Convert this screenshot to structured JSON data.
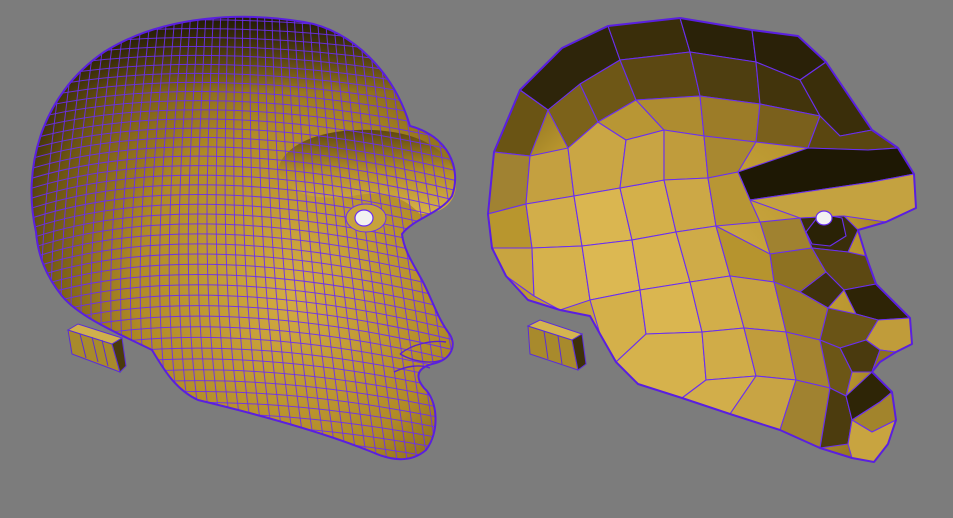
{
  "viewport": {
    "background": "#7c7c7c",
    "models": [
      {
        "id": "smooth",
        "shading": "smooth",
        "surface_light": "#c8a23a",
        "surface_mid": "#9c7a1e",
        "surface_dark": "#3a2c08",
        "wire_color": "#6a2ff0"
      },
      {
        "id": "faceted",
        "shading": "flat",
        "surface_light": "#d2b048",
        "surface_mid": "#a08230",
        "surface_dark": "#2e2608",
        "wire_color": "#6a2ff0"
      }
    ]
  }
}
